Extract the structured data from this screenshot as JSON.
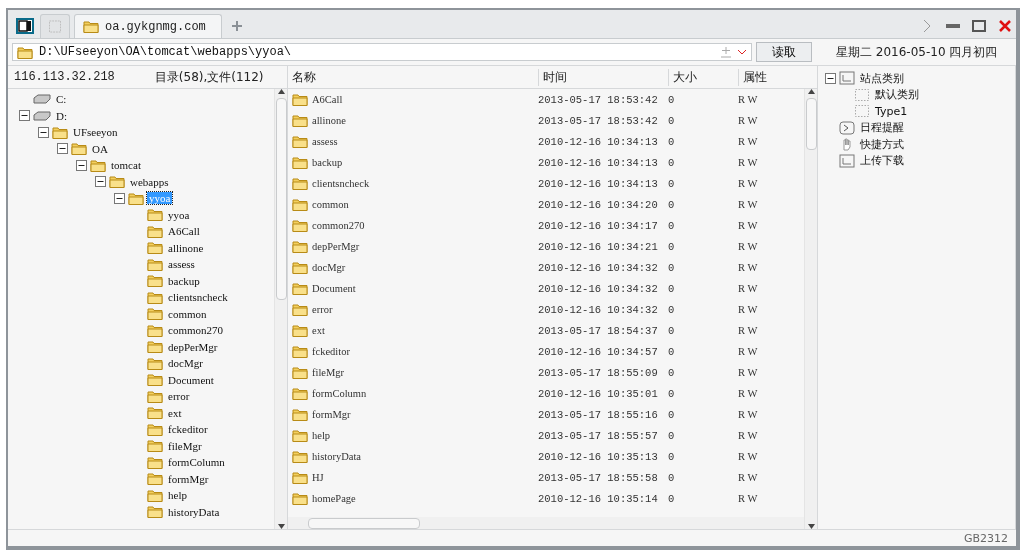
{
  "tabs": [
    {
      "kind": "blank",
      "selected": false
    },
    {
      "kind": "site",
      "label": "oa.gykgnmg.com",
      "selected": true
    }
  ],
  "address": {
    "value": "D:\\UFseeyon\\OA\\tomcat\\webapps\\yyoa\\",
    "button": "读取"
  },
  "date": "星期二 2016-05-10 四月初四",
  "left": {
    "host": "116.113.32.218",
    "summary": "目录(58),文件(112)",
    "tree": [
      {
        "label": "C:",
        "kind": "drive",
        "selected": false
      },
      {
        "label": "D:",
        "kind": "drive",
        "selected": false,
        "expanded": true,
        "children": [
          {
            "label": "UFseeyon",
            "kind": "folder",
            "selected": false,
            "expanded": true,
            "children": [
              {
                "label": "OA",
                "kind": "folder",
                "selected": false,
                "expanded": true,
                "children": [
                  {
                    "label": "tomcat",
                    "kind": "folder",
                    "selected": false,
                    "expanded": true,
                    "children": [
                      {
                        "label": "webapps",
                        "kind": "folder",
                        "selected": false,
                        "expanded": true,
                        "children": [
                          {
                            "label": "yyoa",
                            "kind": "folder",
                            "selected": true,
                            "expanded": true,
                            "children": [
                              {
                                "label": "yyoa",
                                "kind": "folder",
                                "selected": false
                              },
                              {
                                "label": "A6Call",
                                "kind": "folder",
                                "selected": false
                              },
                              {
                                "label": "allinone",
                                "kind": "folder",
                                "selected": false
                              },
                              {
                                "label": "assess",
                                "kind": "folder",
                                "selected": false
                              },
                              {
                                "label": "backup",
                                "kind": "folder",
                                "selected": false
                              },
                              {
                                "label": "clientsncheck",
                                "kind": "folder",
                                "selected": false
                              },
                              {
                                "label": "common",
                                "kind": "folder",
                                "selected": false
                              },
                              {
                                "label": "common270",
                                "kind": "folder",
                                "selected": false
                              },
                              {
                                "label": "depPerMgr",
                                "kind": "folder",
                                "selected": false
                              },
                              {
                                "label": "docMgr",
                                "kind": "folder",
                                "selected": false
                              },
                              {
                                "label": "Document",
                                "kind": "folder",
                                "selected": false
                              },
                              {
                                "label": "error",
                                "kind": "folder",
                                "selected": false
                              },
                              {
                                "label": "ext",
                                "kind": "folder",
                                "selected": false
                              },
                              {
                                "label": "fckeditor",
                                "kind": "folder",
                                "selected": false
                              },
                              {
                                "label": "fileMgr",
                                "kind": "folder",
                                "selected": false
                              },
                              {
                                "label": "formColumn",
                                "kind": "folder",
                                "selected": false
                              },
                              {
                                "label": "formMgr",
                                "kind": "folder",
                                "selected": false
                              },
                              {
                                "label": "help",
                                "kind": "folder",
                                "selected": false
                              },
                              {
                                "label": "historyData",
                                "kind": "folder",
                                "selected": false
                              }
                            ]
                          }
                        ]
                      }
                    ]
                  }
                ]
              }
            ]
          }
        ]
      }
    ]
  },
  "table": {
    "columns": [
      "名称",
      "时间",
      "大小",
      "属性"
    ],
    "rows": [
      {
        "name": "A6Call",
        "time": "2013-05-17 18:53:42",
        "size": "0",
        "attr": "R W"
      },
      {
        "name": "allinone",
        "time": "2013-05-17 18:53:42",
        "size": "0",
        "attr": "R W"
      },
      {
        "name": "assess",
        "time": "2010-12-16 10:34:13",
        "size": "0",
        "attr": "R W"
      },
      {
        "name": "backup",
        "time": "2010-12-16 10:34:13",
        "size": "0",
        "attr": "R W"
      },
      {
        "name": "clientsncheck",
        "time": "2010-12-16 10:34:13",
        "size": "0",
        "attr": "R W"
      },
      {
        "name": "common",
        "time": "2010-12-16 10:34:20",
        "size": "0",
        "attr": "R W"
      },
      {
        "name": "common270",
        "time": "2010-12-16 10:34:17",
        "size": "0",
        "attr": "R W"
      },
      {
        "name": "depPerMgr",
        "time": "2010-12-16 10:34:21",
        "size": "0",
        "attr": "R W"
      },
      {
        "name": "docMgr",
        "time": "2010-12-16 10:34:32",
        "size": "0",
        "attr": "R W"
      },
      {
        "name": "Document",
        "time": "2010-12-16 10:34:32",
        "size": "0",
        "attr": "R W"
      },
      {
        "name": "error",
        "time": "2010-12-16 10:34:32",
        "size": "0",
        "attr": "R W"
      },
      {
        "name": "ext",
        "time": "2013-05-17 18:54:37",
        "size": "0",
        "attr": "R W"
      },
      {
        "name": "fckeditor",
        "time": "2010-12-16 10:34:57",
        "size": "0",
        "attr": "R W"
      },
      {
        "name": "fileMgr",
        "time": "2013-05-17 18:55:09",
        "size": "0",
        "attr": "R W"
      },
      {
        "name": "formColumn",
        "time": "2010-12-16 10:35:01",
        "size": "0",
        "attr": "R W"
      },
      {
        "name": "formMgr",
        "time": "2013-05-17 18:55:16",
        "size": "0",
        "attr": "R W"
      },
      {
        "name": "help",
        "time": "2013-05-17 18:55:57",
        "size": "0",
        "attr": "R W"
      },
      {
        "name": "historyData",
        "time": "2010-12-16 10:35:13",
        "size": "0",
        "attr": "R W"
      },
      {
        "name": "HJ",
        "time": "2013-05-17 18:55:58",
        "size": "0",
        "attr": "R W"
      },
      {
        "name": "homePage",
        "time": "2010-12-16 10:35:14",
        "size": "0",
        "attr": "R W"
      }
    ]
  },
  "right": {
    "tree": [
      {
        "label": "站点类别",
        "kind": "category",
        "expanded": true,
        "children": [
          {
            "label": "默认类别",
            "kind": "item"
          },
          {
            "label": "Type1",
            "kind": "item"
          }
        ]
      },
      {
        "label": "日程提醒",
        "kind": "clock"
      },
      {
        "label": "快捷方式",
        "kind": "hand"
      },
      {
        "label": "上传下载",
        "kind": "category"
      }
    ]
  },
  "status": {
    "encoding": "GB2312"
  }
}
